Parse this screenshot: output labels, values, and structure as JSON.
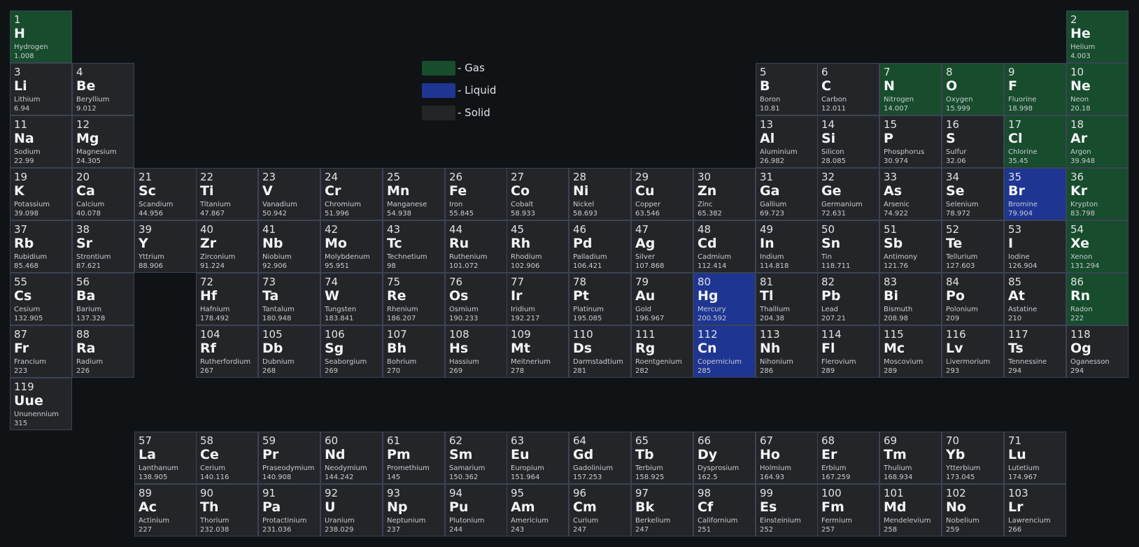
{
  "legend": [
    {
      "label": "- Gas",
      "color": "#174c2c"
    },
    {
      "label": "- Liquid",
      "color": "#1f3592"
    },
    {
      "label": "- Solid",
      "color": "#242528"
    }
  ],
  "elements": [
    {
      "number": "1",
      "symbol": "H",
      "name": "Hydrogen",
      "mass": "1.008",
      "row": 1,
      "col": 1,
      "state": "gas"
    },
    {
      "number": "2",
      "symbol": "He",
      "name": "Helium",
      "mass": "4.003",
      "row": 1,
      "col": 18,
      "state": "gas"
    },
    {
      "number": "3",
      "symbol": "Li",
      "name": "Lithium",
      "mass": "6.94",
      "row": 2,
      "col": 1,
      "state": "solid"
    },
    {
      "number": "4",
      "symbol": "Be",
      "name": "Beryllium",
      "mass": "9.012",
      "row": 2,
      "col": 2,
      "state": "solid"
    },
    {
      "number": "5",
      "symbol": "B",
      "name": "Boron",
      "mass": "10.81",
      "row": 2,
      "col": 13,
      "state": "solid"
    },
    {
      "number": "6",
      "symbol": "C",
      "name": "Carbon",
      "mass": "12.011",
      "row": 2,
      "col": 14,
      "state": "solid"
    },
    {
      "number": "7",
      "symbol": "N",
      "name": "Nitrogen",
      "mass": "14.007",
      "row": 2,
      "col": 15,
      "state": "gas"
    },
    {
      "number": "8",
      "symbol": "O",
      "name": "Oxygen",
      "mass": "15.999",
      "row": 2,
      "col": 16,
      "state": "gas"
    },
    {
      "number": "9",
      "symbol": "F",
      "name": "Fluorine",
      "mass": "18.998",
      "row": 2,
      "col": 17,
      "state": "gas"
    },
    {
      "number": "10",
      "symbol": "Ne",
      "name": "Neon",
      "mass": "20.18",
      "row": 2,
      "col": 18,
      "state": "gas"
    },
    {
      "number": "11",
      "symbol": "Na",
      "name": "Sodium",
      "mass": "22.99",
      "row": 3,
      "col": 1,
      "state": "solid"
    },
    {
      "number": "12",
      "symbol": "Mg",
      "name": "Magnesium",
      "mass": "24.305",
      "row": 3,
      "col": 2,
      "state": "solid"
    },
    {
      "number": "13",
      "symbol": "Al",
      "name": "Aluminium",
      "mass": "26.982",
      "row": 3,
      "col": 13,
      "state": "solid"
    },
    {
      "number": "14",
      "symbol": "Si",
      "name": "Silicon",
      "mass": "28.085",
      "row": 3,
      "col": 14,
      "state": "solid"
    },
    {
      "number": "15",
      "symbol": "P",
      "name": "Phosphorus",
      "mass": "30.974",
      "row": 3,
      "col": 15,
      "state": "solid"
    },
    {
      "number": "16",
      "symbol": "S",
      "name": "Sulfur",
      "mass": "32.06",
      "row": 3,
      "col": 16,
      "state": "solid"
    },
    {
      "number": "17",
      "symbol": "Cl",
      "name": "Chlorine",
      "mass": "35.45",
      "row": 3,
      "col": 17,
      "state": "gas"
    },
    {
      "number": "18",
      "symbol": "Ar",
      "name": "Argon",
      "mass": "39.948",
      "row": 3,
      "col": 18,
      "state": "gas"
    },
    {
      "number": "19",
      "symbol": "K",
      "name": "Potassium",
      "mass": "39.098",
      "row": 4,
      "col": 1,
      "state": "solid"
    },
    {
      "number": "20",
      "symbol": "Ca",
      "name": "Calcium",
      "mass": "40.078",
      "row": 4,
      "col": 2,
      "state": "solid"
    },
    {
      "number": "21",
      "symbol": "Sc",
      "name": "Scandium",
      "mass": "44.956",
      "row": 4,
      "col": 3,
      "state": "solid"
    },
    {
      "number": "22",
      "symbol": "Ti",
      "name": "Titanium",
      "mass": "47.867",
      "row": 4,
      "col": 4,
      "state": "solid"
    },
    {
      "number": "23",
      "symbol": "V",
      "name": "Vanadium",
      "mass": "50.942",
      "row": 4,
      "col": 5,
      "state": "solid"
    },
    {
      "number": "24",
      "symbol": "Cr",
      "name": "Chromium",
      "mass": "51.996",
      "row": 4,
      "col": 6,
      "state": "solid"
    },
    {
      "number": "25",
      "symbol": "Mn",
      "name": "Manganese",
      "mass": "54.938",
      "row": 4,
      "col": 7,
      "state": "solid"
    },
    {
      "number": "26",
      "symbol": "Fe",
      "name": "Iron",
      "mass": "55.845",
      "row": 4,
      "col": 8,
      "state": "solid"
    },
    {
      "number": "27",
      "symbol": "Co",
      "name": "Cobalt",
      "mass": "58.933",
      "row": 4,
      "col": 9,
      "state": "solid"
    },
    {
      "number": "28",
      "symbol": "Ni",
      "name": "Nickel",
      "mass": "58.693",
      "row": 4,
      "col": 10,
      "state": "solid"
    },
    {
      "number": "29",
      "symbol": "Cu",
      "name": "Copper",
      "mass": "63.546",
      "row": 4,
      "col": 11,
      "state": "solid"
    },
    {
      "number": "30",
      "symbol": "Zn",
      "name": "Zinc",
      "mass": "65.382",
      "row": 4,
      "col": 12,
      "state": "solid"
    },
    {
      "number": "31",
      "symbol": "Ga",
      "name": "Gallium",
      "mass": "69.723",
      "row": 4,
      "col": 13,
      "state": "solid"
    },
    {
      "number": "32",
      "symbol": "Ge",
      "name": "Germanium",
      "mass": "72.631",
      "row": 4,
      "col": 14,
      "state": "solid"
    },
    {
      "number": "33",
      "symbol": "As",
      "name": "Arsenic",
      "mass": "74.922",
      "row": 4,
      "col": 15,
      "state": "solid"
    },
    {
      "number": "34",
      "symbol": "Se",
      "name": "Selenium",
      "mass": "78.972",
      "row": 4,
      "col": 16,
      "state": "solid"
    },
    {
      "number": "35",
      "symbol": "Br",
      "name": "Bromine",
      "mass": "79.904",
      "row": 4,
      "col": 17,
      "state": "liquid"
    },
    {
      "number": "36",
      "symbol": "Kr",
      "name": "Krypton",
      "mass": "83.798",
      "row": 4,
      "col": 18,
      "state": "gas"
    },
    {
      "number": "37",
      "symbol": "Rb",
      "name": "Rubidium",
      "mass": "85.468",
      "row": 5,
      "col": 1,
      "state": "solid"
    },
    {
      "number": "38",
      "symbol": "Sr",
      "name": "Strontium",
      "mass": "87.621",
      "row": 5,
      "col": 2,
      "state": "solid"
    },
    {
      "number": "39",
      "symbol": "Y",
      "name": "Yttrium",
      "mass": "88.906",
      "row": 5,
      "col": 3,
      "state": "solid"
    },
    {
      "number": "40",
      "symbol": "Zr",
      "name": "Zirconium",
      "mass": "91.224",
      "row": 5,
      "col": 4,
      "state": "solid"
    },
    {
      "number": "41",
      "symbol": "Nb",
      "name": "Niobium",
      "mass": "92.906",
      "row": 5,
      "col": 5,
      "state": "solid"
    },
    {
      "number": "42",
      "symbol": "Mo",
      "name": "Molybdenum",
      "mass": "95.951",
      "row": 5,
      "col": 6,
      "state": "solid"
    },
    {
      "number": "43",
      "symbol": "Tc",
      "name": "Technetium",
      "mass": "98",
      "row": 5,
      "col": 7,
      "state": "solid"
    },
    {
      "number": "44",
      "symbol": "Ru",
      "name": "Ruthenium",
      "mass": "101.072",
      "row": 5,
      "col": 8,
      "state": "solid"
    },
    {
      "number": "45",
      "symbol": "Rh",
      "name": "Rhodium",
      "mass": "102.906",
      "row": 5,
      "col": 9,
      "state": "solid"
    },
    {
      "number": "46",
      "symbol": "Pd",
      "name": "Palladium",
      "mass": "106.421",
      "row": 5,
      "col": 10,
      "state": "solid"
    },
    {
      "number": "47",
      "symbol": "Ag",
      "name": "Silver",
      "mass": "107.868",
      "row": 5,
      "col": 11,
      "state": "solid"
    },
    {
      "number": "48",
      "symbol": "Cd",
      "name": "Cadmium",
      "mass": "112.414",
      "row": 5,
      "col": 12,
      "state": "solid"
    },
    {
      "number": "49",
      "symbol": "In",
      "name": "Indium",
      "mass": "114.818",
      "row": 5,
      "col": 13,
      "state": "solid"
    },
    {
      "number": "50",
      "symbol": "Sn",
      "name": "Tin",
      "mass": "118.711",
      "row": 5,
      "col": 14,
      "state": "solid"
    },
    {
      "number": "51",
      "symbol": "Sb",
      "name": "Antimony",
      "mass": "121.76",
      "row": 5,
      "col": 15,
      "state": "solid"
    },
    {
      "number": "52",
      "symbol": "Te",
      "name": "Tellurium",
      "mass": "127.603",
      "row": 5,
      "col": 16,
      "state": "solid"
    },
    {
      "number": "53",
      "symbol": "I",
      "name": "Iodine",
      "mass": "126.904",
      "row": 5,
      "col": 17,
      "state": "solid"
    },
    {
      "number": "54",
      "symbol": "Xe",
      "name": "Xenon",
      "mass": "131.294",
      "row": 5,
      "col": 18,
      "state": "gas"
    },
    {
      "number": "55",
      "symbol": "Cs",
      "name": "Cesium",
      "mass": "132.905",
      "row": 6,
      "col": 1,
      "state": "solid"
    },
    {
      "number": "56",
      "symbol": "Ba",
      "name": "Barium",
      "mass": "137.328",
      "row": 6,
      "col": 2,
      "state": "solid"
    },
    {
      "number": "72",
      "symbol": "Hf",
      "name": "Hafnium",
      "mass": "178.492",
      "row": 6,
      "col": 4,
      "state": "solid"
    },
    {
      "number": "73",
      "symbol": "Ta",
      "name": "Tantalum",
      "mass": "180.948",
      "row": 6,
      "col": 5,
      "state": "solid"
    },
    {
      "number": "74",
      "symbol": "W",
      "name": "Tungsten",
      "mass": "183.841",
      "row": 6,
      "col": 6,
      "state": "solid"
    },
    {
      "number": "75",
      "symbol": "Re",
      "name": "Rhenium",
      "mass": "186.207",
      "row": 6,
      "col": 7,
      "state": "solid"
    },
    {
      "number": "76",
      "symbol": "Os",
      "name": "Osmium",
      "mass": "190.233",
      "row": 6,
      "col": 8,
      "state": "solid"
    },
    {
      "number": "77",
      "symbol": "Ir",
      "name": "Iridium",
      "mass": "192.217",
      "row": 6,
      "col": 9,
      "state": "solid"
    },
    {
      "number": "78",
      "symbol": "Pt",
      "name": "Platinum",
      "mass": "195.085",
      "row": 6,
      "col": 10,
      "state": "solid"
    },
    {
      "number": "79",
      "symbol": "Au",
      "name": "Gold",
      "mass": "196.967",
      "row": 6,
      "col": 11,
      "state": "solid"
    },
    {
      "number": "80",
      "symbol": "Hg",
      "name": "Mercury",
      "mass": "200.592",
      "row": 6,
      "col": 12,
      "state": "liquid"
    },
    {
      "number": "81",
      "symbol": "Tl",
      "name": "Thallium",
      "mass": "204.38",
      "row": 6,
      "col": 13,
      "state": "solid"
    },
    {
      "number": "82",
      "symbol": "Pb",
      "name": "Lead",
      "mass": "207.21",
      "row": 6,
      "col": 14,
      "state": "solid"
    },
    {
      "number": "83",
      "symbol": "Bi",
      "name": "Bismuth",
      "mass": "208.98",
      "row": 6,
      "col": 15,
      "state": "solid"
    },
    {
      "number": "84",
      "symbol": "Po",
      "name": "Polonium",
      "mass": "209",
      "row": 6,
      "col": 16,
      "state": "solid"
    },
    {
      "number": "85",
      "symbol": "At",
      "name": "Astatine",
      "mass": "210",
      "row": 6,
      "col": 17,
      "state": "solid"
    },
    {
      "number": "86",
      "symbol": "Rn",
      "name": "Radon",
      "mass": "222",
      "row": 6,
      "col": 18,
      "state": "gas"
    },
    {
      "number": "87",
      "symbol": "Fr",
      "name": "Francium",
      "mass": "223",
      "row": 7,
      "col": 1,
      "state": "solid"
    },
    {
      "number": "88",
      "symbol": "Ra",
      "name": "Radium",
      "mass": "226",
      "row": 7,
      "col": 2,
      "state": "solid"
    },
    {
      "number": "104",
      "symbol": "Rf",
      "name": "Rutherfordium",
      "mass": "267",
      "row": 7,
      "col": 4,
      "state": "solid"
    },
    {
      "number": "105",
      "symbol": "Db",
      "name": "Dubnium",
      "mass": "268",
      "row": 7,
      "col": 5,
      "state": "solid"
    },
    {
      "number": "106",
      "symbol": "Sg",
      "name": "Seaborgium",
      "mass": "269",
      "row": 7,
      "col": 6,
      "state": "solid"
    },
    {
      "number": "107",
      "symbol": "Bh",
      "name": "Bohrium",
      "mass": "270",
      "row": 7,
      "col": 7,
      "state": "solid"
    },
    {
      "number": "108",
      "symbol": "Hs",
      "name": "Hassium",
      "mass": "269",
      "row": 7,
      "col": 8,
      "state": "solid"
    },
    {
      "number": "109",
      "symbol": "Mt",
      "name": "Meitnerium",
      "mass": "278",
      "row": 7,
      "col": 9,
      "state": "solid"
    },
    {
      "number": "110",
      "symbol": "Ds",
      "name": "Darmstadtium",
      "mass": "281",
      "row": 7,
      "col": 10,
      "state": "solid"
    },
    {
      "number": "111",
      "symbol": "Rg",
      "name": "Roentgenium",
      "mass": "282",
      "row": 7,
      "col": 11,
      "state": "solid"
    },
    {
      "number": "112",
      "symbol": "Cn",
      "name": "Copernicium",
      "mass": "285",
      "row": 7,
      "col": 12,
      "state": "liquid"
    },
    {
      "number": "113",
      "symbol": "Nh",
      "name": "Nihonium",
      "mass": "286",
      "row": 7,
      "col": 13,
      "state": "solid"
    },
    {
      "number": "114",
      "symbol": "Fl",
      "name": "Flerovium",
      "mass": "289",
      "row": 7,
      "col": 14,
      "state": "solid"
    },
    {
      "number": "115",
      "symbol": "Mc",
      "name": "Moscovium",
      "mass": "289",
      "row": 7,
      "col": 15,
      "state": "solid"
    },
    {
      "number": "116",
      "symbol": "Lv",
      "name": "Livermorium",
      "mass": "293",
      "row": 7,
      "col": 16,
      "state": "solid"
    },
    {
      "number": "117",
      "symbol": "Ts",
      "name": "Tennessine",
      "mass": "294",
      "row": 7,
      "col": 17,
      "state": "solid"
    },
    {
      "number": "118",
      "symbol": "Og",
      "name": "Oganesson",
      "mass": "294",
      "row": 7,
      "col": 18,
      "state": "solid"
    },
    {
      "number": "119",
      "symbol": "Uue",
      "name": "Ununennium",
      "mass": "315",
      "row": 8,
      "col": 1,
      "state": "solid"
    },
    {
      "number": "57",
      "symbol": "La",
      "name": "Lanthanum",
      "mass": "138.905",
      "row": 9,
      "col": 3,
      "state": "solid"
    },
    {
      "number": "58",
      "symbol": "Ce",
      "name": "Cerium",
      "mass": "140.116",
      "row": 9,
      "col": 4,
      "state": "solid"
    },
    {
      "number": "59",
      "symbol": "Pr",
      "name": "Praseodymium",
      "mass": "140.908",
      "row": 9,
      "col": 5,
      "state": "solid"
    },
    {
      "number": "60",
      "symbol": "Nd",
      "name": "Neodymium",
      "mass": "144.242",
      "row": 9,
      "col": 6,
      "state": "solid"
    },
    {
      "number": "61",
      "symbol": "Pm",
      "name": "Promethium",
      "mass": "145",
      "row": 9,
      "col": 7,
      "state": "solid"
    },
    {
      "number": "62",
      "symbol": "Sm",
      "name": "Samarium",
      "mass": "150.362",
      "row": 9,
      "col": 8,
      "state": "solid"
    },
    {
      "number": "63",
      "symbol": "Eu",
      "name": "Europium",
      "mass": "151.964",
      "row": 9,
      "col": 9,
      "state": "solid"
    },
    {
      "number": "64",
      "symbol": "Gd",
      "name": "Gadolinium",
      "mass": "157.253",
      "row": 9,
      "col": 10,
      "state": "solid"
    },
    {
      "number": "65",
      "symbol": "Tb",
      "name": "Terbium",
      "mass": "158.925",
      "row": 9,
      "col": 11,
      "state": "solid"
    },
    {
      "number": "66",
      "symbol": "Dy",
      "name": "Dysprosium",
      "mass": "162.5",
      "row": 9,
      "col": 12,
      "state": "solid"
    },
    {
      "number": "67",
      "symbol": "Ho",
      "name": "Holmium",
      "mass": "164.93",
      "row": 9,
      "col": 13,
      "state": "solid"
    },
    {
      "number": "68",
      "symbol": "Er",
      "name": "Erbium",
      "mass": "167.259",
      "row": 9,
      "col": 14,
      "state": "solid"
    },
    {
      "number": "69",
      "symbol": "Tm",
      "name": "Thulium",
      "mass": "168.934",
      "row": 9,
      "col": 15,
      "state": "solid"
    },
    {
      "number": "70",
      "symbol": "Yb",
      "name": "Ytterbium",
      "mass": "173.045",
      "row": 9,
      "col": 16,
      "state": "solid"
    },
    {
      "number": "71",
      "symbol": "Lu",
      "name": "Lutetium",
      "mass": "174.967",
      "row": 9,
      "col": 17,
      "state": "solid"
    },
    {
      "number": "89",
      "symbol": "Ac",
      "name": "Actinium",
      "mass": "227",
      "row": 10,
      "col": 3,
      "state": "solid"
    },
    {
      "number": "90",
      "symbol": "Th",
      "name": "Thorium",
      "mass": "232.038",
      "row": 10,
      "col": 4,
      "state": "solid"
    },
    {
      "number": "91",
      "symbol": "Pa",
      "name": "Protactinium",
      "mass": "231.036",
      "row": 10,
      "col": 5,
      "state": "solid"
    },
    {
      "number": "92",
      "symbol": "U",
      "name": "Uranium",
      "mass": "238.029",
      "row": 10,
      "col": 6,
      "state": "solid"
    },
    {
      "number": "93",
      "symbol": "Np",
      "name": "Neptunium",
      "mass": "237",
      "row": 10,
      "col": 7,
      "state": "solid"
    },
    {
      "number": "94",
      "symbol": "Pu",
      "name": "Plutonium",
      "mass": "244",
      "row": 10,
      "col": 8,
      "state": "solid"
    },
    {
      "number": "95",
      "symbol": "Am",
      "name": "Americium",
      "mass": "243",
      "row": 10,
      "col": 9,
      "state": "solid"
    },
    {
      "number": "96",
      "symbol": "Cm",
      "name": "Curium",
      "mass": "247",
      "row": 10,
      "col": 10,
      "state": "solid"
    },
    {
      "number": "97",
      "symbol": "Bk",
      "name": "Berkelium",
      "mass": "247",
      "row": 10,
      "col": 11,
      "state": "solid"
    },
    {
      "number": "98",
      "symbol": "Cf",
      "name": "Californium",
      "mass": "251",
      "row": 10,
      "col": 12,
      "state": "solid"
    },
    {
      "number": "99",
      "symbol": "Es",
      "name": "Einsteinium",
      "mass": "252",
      "row": 10,
      "col": 13,
      "state": "solid"
    },
    {
      "number": "100",
      "symbol": "Fm",
      "name": "Fermium",
      "mass": "257",
      "row": 10,
      "col": 14,
      "state": "solid"
    },
    {
      "number": "101",
      "symbol": "Md",
      "name": "Mendelevium",
      "mass": "258",
      "row": 10,
      "col": 15,
      "state": "solid"
    },
    {
      "number": "102",
      "symbol": "No",
      "name": "Nobelium",
      "mass": "259",
      "row": 10,
      "col": 16,
      "state": "solid"
    },
    {
      "number": "103",
      "symbol": "Lr",
      "name": "Lawrencium",
      "mass": "266",
      "row": 10,
      "col": 17,
      "state": "solid"
    }
  ]
}
